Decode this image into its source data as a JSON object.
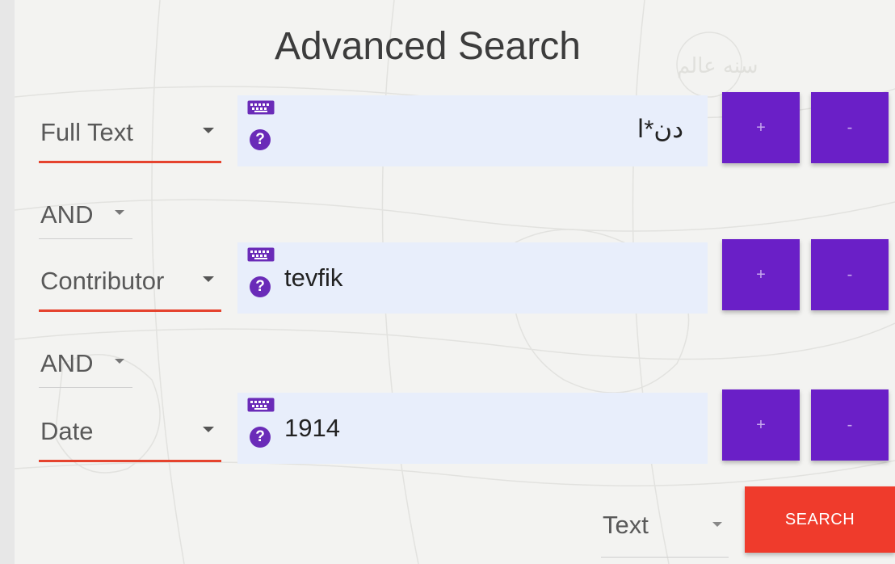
{
  "title": "Advanced Search",
  "colors": {
    "primary": "#6a1fc7",
    "accent": "#ef3b2c",
    "input_bg": "#e8eefb",
    "underline": "#e5432e"
  },
  "rows": [
    {
      "field": "Full Text",
      "value": "دن*ا",
      "plus_label": "+",
      "minus_label": "-"
    },
    {
      "field": "Contributor",
      "value": "tevfik",
      "plus_label": "+",
      "minus_label": "-"
    },
    {
      "field": "Date",
      "value": "1914",
      "plus_label": "+",
      "minus_label": "-"
    }
  ],
  "operators": [
    {
      "label": "AND"
    },
    {
      "label": "AND"
    }
  ],
  "format": {
    "selected": "Text"
  },
  "search_button": {
    "label": "SEARCH"
  },
  "icons": {
    "keyboard": "keyboard-icon",
    "help": "question-icon",
    "dropdown": "caret-down-icon"
  },
  "help_glyph": "?"
}
